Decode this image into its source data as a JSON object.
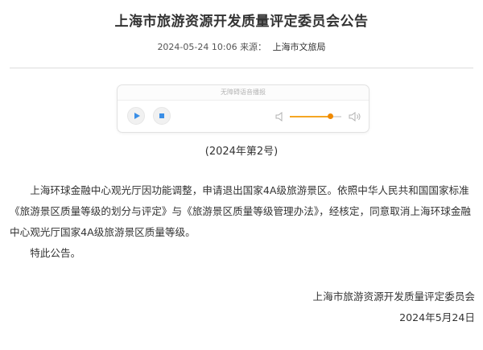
{
  "article": {
    "title": "上海市旅游资源开发质量评定委员会公告",
    "datetime": "2024-05-24 10:06",
    "source_label": "来源：",
    "source_name": "上海市文旅局"
  },
  "player": {
    "caption": "无障碍语音播报",
    "play_icon": "play-icon",
    "stop_icon": "stop-icon",
    "volume_low_icon": "volume-low-icon",
    "volume_high_icon": "volume-high-icon",
    "volume_level": 0.78,
    "accent_color": "#f5a623",
    "button_color": "#3a8ee6"
  },
  "document": {
    "number": "(2024年第2号)",
    "paragraph_1": "上海环球金融中心观光厅因功能调整，申请退出国家4A级旅游景区。依照中华人民共和国国家标准《旅游景区质量等级的划分与评定》与《旅游景区质量等级管理办法》，经核定，同意取消上海环球金融中心观光厅国家4A级旅游景区质量等级。",
    "paragraph_2": "特此公告。",
    "signer": "上海市旅游资源开发质量评定委员会",
    "sign_date": "2024年5月24日"
  }
}
